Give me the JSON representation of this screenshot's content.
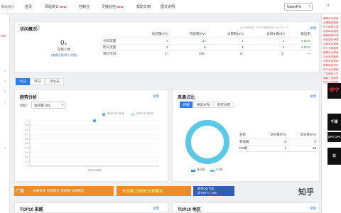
{
  "topbar": {
    "brand": "网站统计",
    "nav": [
      {
        "label": "首页",
        "badge": ""
      },
      {
        "label": "网站统计",
        "badge": "NEW"
      },
      {
        "label": "控制台",
        "badge": ""
      },
      {
        "label": "灵敏监控",
        "badge": "NEW"
      },
      {
        "label": "帮助文档",
        "badge": ""
      },
      {
        "label": "图文说明",
        "badge": ""
      }
    ],
    "site_select": "NatsePel",
    "close_glyph": "×",
    "chevron": "▾"
  },
  "sidebar": {
    "red_text": "360",
    "arrow_glyph": "›"
  },
  "overview": {
    "title": "访问概况",
    "info_icon": "?",
    "meta": "51LA网络版 · 75979   更新时间: 2022-07-29",
    "help": "详情",
    "online_count": "0",
    "online_unit": "人",
    "online_label": "在线人数",
    "online_link": "(查看在线用户详细)",
    "columns": [
      "",
      "访问量(PV)",
      "浏览量(PV)",
      "访客数(UV)",
      "访问IP数(IP)",
      "跳出率"
    ],
    "rows": [
      [
        "今日流量",
        "1",
        "32",
        "1",
        "1",
        "0.00%"
      ],
      [
        "昨日流量",
        "1",
        "6",
        "1",
        "1",
        "0.00%"
      ],
      [
        "预计今日",
        "0",
        "180",
        "0",
        "0",
        "—"
      ]
    ],
    "up_glyph": "↑"
  },
  "range_tabs": [
    "今日",
    "昨日",
    "近七天"
  ],
  "trend": {
    "title": "趋势分析",
    "help": "详情",
    "metric_label": "指标：",
    "metric_value": "访问量 (IP)",
    "legend": [
      "2022-07-29 IP",
      "2022-07-25 IP"
    ]
  },
  "source": {
    "title": "来源占比",
    "help": "详情",
    "tabs": [
      "终端",
      "来源分布",
      "新老访客"
    ],
    "table_headers": [
      "名称",
      "访问量(PV)",
      "浏览量(PV)"
    ],
    "rows": [
      [
        "移动端",
        "0",
        "0"
      ],
      [
        "PC端",
        "1",
        "22"
      ]
    ],
    "legend": [
      "移动端",
      "PC端"
    ]
  },
  "chart_data": {
    "type": "line",
    "x": [
      "07/29 00时"
    ],
    "series": [
      {
        "name": "2022-07-29 IP",
        "values": [
          1
        ]
      },
      {
        "name": "2022-07-25 IP",
        "values": [
          1
        ]
      }
    ],
    "ylim": [
      0,
      1
    ],
    "yticks": [
      "0",
      "0.1",
      "0.2",
      "0.3",
      "0.4",
      "0.5",
      "0.6",
      "0.7",
      "0.8",
      "0.9",
      "1"
    ],
    "grid": true,
    "legend_position": "top-right",
    "colors": [
      "#2b7de9",
      "#9bd0f0"
    ]
  },
  "pie_data": {
    "type": "pie",
    "categories": [
      "移动端",
      "PC端"
    ],
    "values": [
      0,
      1
    ],
    "colors": [
      "#4a90e2",
      "#5bc8e8"
    ]
  },
  "banners": {
    "left_tag": "广告",
    "left_text": "长期有效 高速稳定 日结算 长期稳定",
    "mid_text": "长免期 日结算 长期稳定",
    "right_line1": "联系QQ飞机",
    "right_line2": "@TomY7_Tom",
    "watermark": "知乎"
  },
  "bottom": {
    "left_title": "TOP10 来路",
    "left_help": "详情",
    "right_title": "TOP10 地区",
    "right_help": "详情"
  },
  "right_ads": {
    "news": [
      "最新资讯推荐",
      "友情链接推荐",
      "热门推荐文章",
      "优质网站推荐",
      "最新推荐内容",
      "网站排行榜单",
      "优秀站点推荐",
      "热门文章推荐",
      "推荐站点更新",
      "站点收录推荐",
      "优质内容推荐",
      "推荐网站排行",
      "热门站点推荐",
      "广告联系方式",
      "最新上线推荐",
      "热门内容推荐"
    ],
    "ad1": "宇宁",
    "ad2": "千颂",
    "ad3": "CPC CPV",
    "ad4": "日"
  },
  "colors": {
    "accent": "#2b7de9",
    "red": "#e33",
    "orange_banner": "#f58a1f",
    "pie_pc": "#5bc8e8"
  }
}
